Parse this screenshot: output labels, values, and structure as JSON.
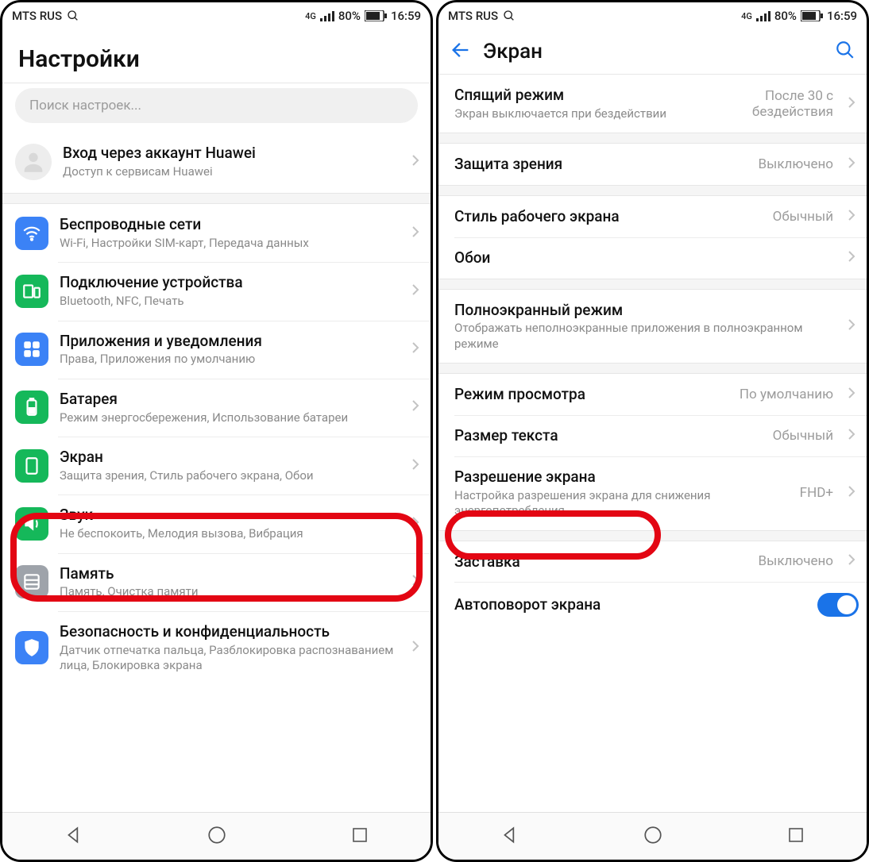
{
  "status": {
    "carrier": "MTS RUS",
    "net": "4G",
    "battery_pct": "80%",
    "time": "16:59"
  },
  "left": {
    "title": "Настройки",
    "search_placeholder": "Поиск настроек...",
    "account": {
      "title": "Вход через аккаунт Huawei",
      "sub": "Доступ к сервисам Huawei"
    },
    "items": [
      {
        "icon": "wifi",
        "color": "icon-blue",
        "title": "Беспроводные сети",
        "sub": "Wi-Fi, Настройки SIM-карт, Передача данных"
      },
      {
        "icon": "device",
        "color": "icon-green",
        "title": "Подключение устройства",
        "sub": "Bluetooth, NFC, Печать"
      },
      {
        "icon": "apps",
        "color": "icon-blue",
        "title": "Приложения и уведомления",
        "sub": "Права, Приложения по умолчанию"
      },
      {
        "icon": "battery",
        "color": "icon-green",
        "title": "Батарея",
        "sub": "Режим энергосбережения, Использование батареи"
      },
      {
        "icon": "display",
        "color": "icon-green",
        "title": "Экран",
        "sub": "Защита зрения, Стиль рабочего экрана, Обои"
      },
      {
        "icon": "sound",
        "color": "icon-green",
        "title": "Звук",
        "sub": "Не беспокоить, Мелодия вызова, Вибрация"
      },
      {
        "icon": "storage",
        "color": "icon-grey",
        "title": "Память",
        "sub": "Память, Очистка памяти"
      },
      {
        "icon": "security",
        "color": "icon-blue",
        "title": "Безопасность и конфиденциальность",
        "sub": "Датчик отпечатка пальца, Разблокировка распознаванием лица, Блокировка экрана"
      }
    ]
  },
  "right": {
    "title": "Экран",
    "items": [
      {
        "title": "Спящий режим",
        "sub": "Экран выключается при бездействии",
        "value": "После 30 с\nбездействия"
      },
      {
        "gap": true
      },
      {
        "title": "Защита зрения",
        "value": "Выключено"
      },
      {
        "gap": true
      },
      {
        "title": "Стиль рабочего экрана",
        "value": "Обычный"
      },
      {
        "title": "Обои",
        "value": ""
      },
      {
        "gap": true
      },
      {
        "title": "Полноэкранный режим",
        "sub": "Отображать неполноэкранные приложения в полноэкранном режиме"
      },
      {
        "gap": true
      },
      {
        "title": "Режим просмотра",
        "value": "По умолчанию"
      },
      {
        "title": "Размер текста",
        "value": "Обычный"
      },
      {
        "title": "Разрешение экрана",
        "sub": "Настройка разрешения экрана для снижения энергопотребления",
        "value": "FHD+"
      },
      {
        "gap": true
      },
      {
        "title": "Заставка",
        "value": "Выключено"
      },
      {
        "title": "Автоповорот экрана",
        "toggle": true
      }
    ]
  }
}
